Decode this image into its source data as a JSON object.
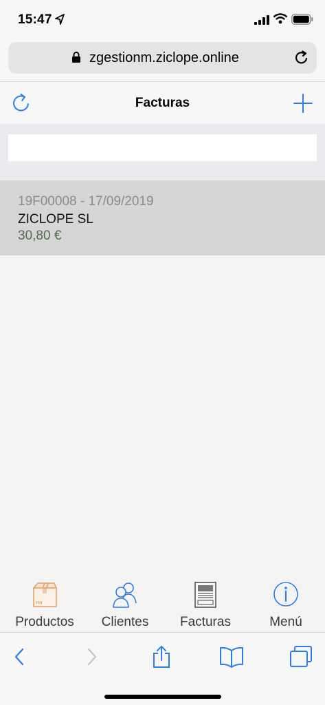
{
  "status_bar": {
    "time": "15:47"
  },
  "browser": {
    "url": "zgestionm.ziclope.online"
  },
  "app": {
    "title": "Facturas",
    "search": {
      "value": "",
      "placeholder": ""
    }
  },
  "invoices": [
    {
      "ref": "19F00008 - 17/09/2019",
      "client": "ZICLOPE SL",
      "amount": "30,80 €"
    }
  ],
  "tabs": [
    {
      "label": "Productos",
      "icon": "box-icon"
    },
    {
      "label": "Clientes",
      "icon": "users-icon"
    },
    {
      "label": "Facturas",
      "icon": "invoice-icon"
    },
    {
      "label": "Menú",
      "icon": "info-icon"
    }
  ],
  "colors": {
    "accent": "#2f7ee6",
    "amount": "#4f6b4c",
    "list_item_bg": "#d6d6d6",
    "box_icon": "#e3a56c"
  }
}
